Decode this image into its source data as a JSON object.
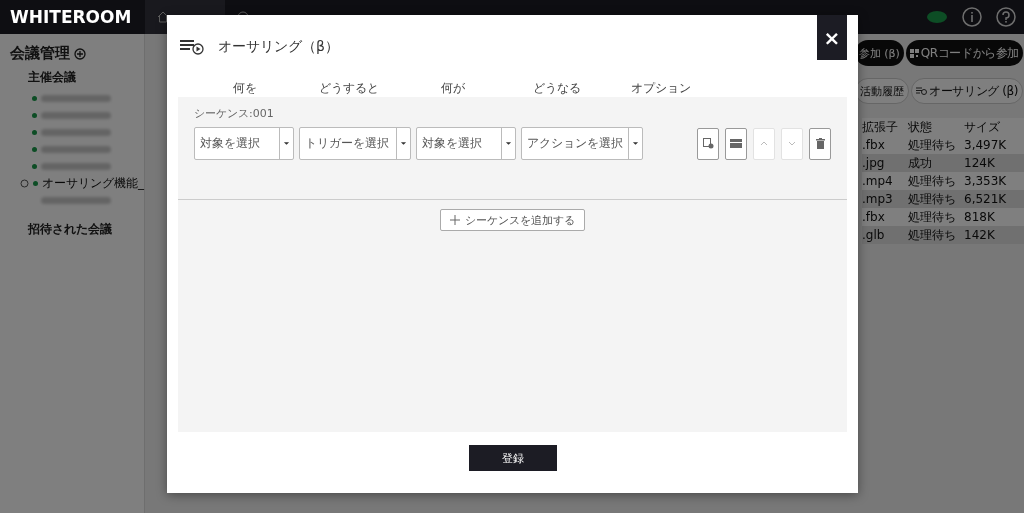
{
  "header": {
    "logo": "WHITEROOM"
  },
  "sidebar": {
    "title": "会議管理",
    "sections": [
      {
        "label": "主催会議",
        "items": [
          {
            "kind": "blurred",
            "dot": true,
            "syncing": false
          },
          {
            "kind": "blurred",
            "dot": true,
            "syncing": false
          },
          {
            "kind": "blurred",
            "dot": true,
            "syncing": false
          },
          {
            "kind": "blurred",
            "dot": true,
            "syncing": false
          },
          {
            "kind": "blurred",
            "dot": true,
            "syncing": false
          },
          {
            "kind": "text",
            "dot": true,
            "syncing": true,
            "label": "オーサリング機能_"
          },
          {
            "kind": "blurred",
            "dot": false,
            "syncing": false
          }
        ]
      },
      {
        "label": "招待された会議"
      }
    ]
  },
  "toolbar": {
    "buttons": [
      {
        "label": "参加 (β)"
      },
      {
        "label": "QRコードから参加"
      }
    ],
    "actions": [
      {
        "label": "活動履歴"
      },
      {
        "label": "オーサリング (β)"
      }
    ]
  },
  "file_table": {
    "columns": [
      "拡張子",
      "状態",
      "サイズ"
    ],
    "rows": [
      {
        "cells": [
          ".fbx",
          "処理待ち",
          "3,497K"
        ]
      },
      {
        "cells": [
          ".jpg",
          "成功",
          "124K"
        ]
      },
      {
        "cells": [
          ".mp4",
          "処理待ち",
          "3,353K"
        ]
      },
      {
        "cells": [
          ".mp3",
          "処理待ち",
          "6,521K"
        ]
      },
      {
        "cells": [
          ".fbx",
          "処理待ち",
          "818K"
        ]
      },
      {
        "cells": [
          ".glb",
          "処理待ち",
          "142K"
        ]
      }
    ]
  },
  "dialog": {
    "title": "オーサリング（β）",
    "close": "×",
    "columns": [
      "何を",
      "どうすると",
      "何が",
      "どうなる",
      "オプション"
    ],
    "sequences": [
      {
        "label": "シーケンス:001",
        "selects": [
          {
            "placeholder": "対象を選択"
          },
          {
            "placeholder": "トリガーを選択"
          },
          {
            "placeholder": "対象を選択"
          },
          {
            "placeholder": "アクションを選択"
          }
        ],
        "tools": [
          {
            "kind": "settings",
            "disabled": false
          },
          {
            "kind": "card",
            "disabled": false
          },
          {
            "kind": "up",
            "disabled": true
          },
          {
            "kind": "down",
            "disabled": true
          },
          {
            "kind": "trash",
            "disabled": false
          }
        ]
      }
    ],
    "add_button": "シーケンスを追加する",
    "submit_button": "登録"
  }
}
